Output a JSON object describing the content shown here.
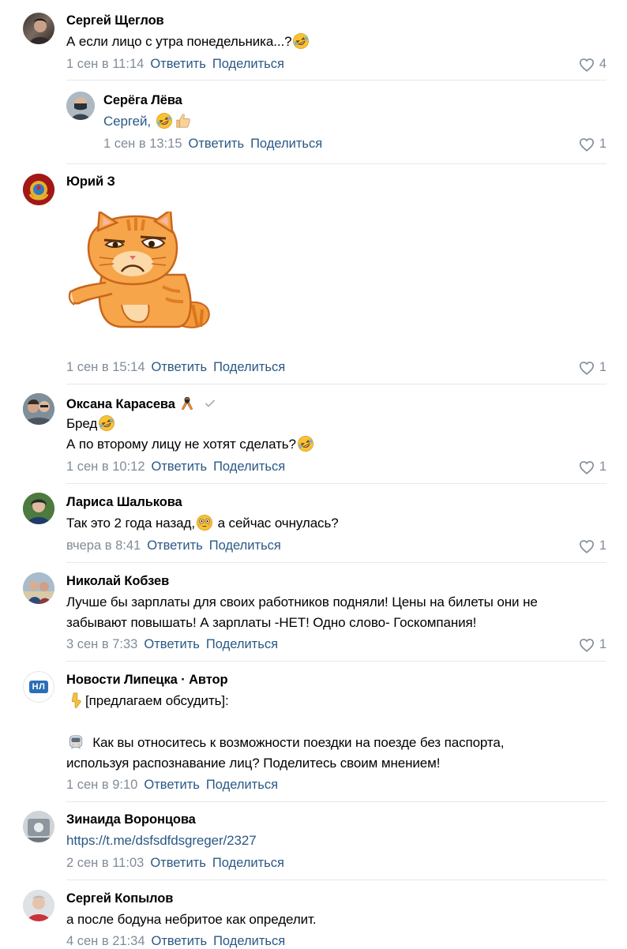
{
  "actions": {
    "reply": "Ответить",
    "share": "Поделиться"
  },
  "colors": {
    "link": "#2a5885",
    "meta": "#818c99",
    "divider": "#e7e8ec",
    "like_icon": "#818c99"
  },
  "comments": [
    {
      "author": "Сергей Щеглов",
      "text": "А если лицо с утра понедельника...?",
      "emoji": [
        "rofl-emoji"
      ],
      "date": "1 сен в 11:14",
      "likes": "4"
    },
    {
      "author": "Серёга Лёва",
      "reply_to": "Сергей,",
      "emoji": [
        "rofl-emoji",
        "thumbs-up-emoji"
      ],
      "date": "1 сен в 13:15",
      "likes": "1"
    },
    {
      "author": "Юрий З",
      "sticker": "grumpy-cat-sticker",
      "date": "1 сен в 15:14",
      "likes": "1"
    },
    {
      "author": "Оксана Карасева",
      "badges": [
        "ribbon-icon",
        "verified-check-icon"
      ],
      "text": "Бред",
      "text2": "А по второму лицу не хотят сделать?",
      "date": "1 сен в 10:12",
      "likes": "1"
    },
    {
      "author": "Лариса Шалькова",
      "text": "Так это 2 года назад,",
      "text_after_emoji": "а сейчас очнулась?",
      "emoji": [
        "flushed-emoji"
      ],
      "date": "вчера в 8:41",
      "likes": "1"
    },
    {
      "author": "Николай Кобзев",
      "text": "Лучше бы зарплаты для своих работников подняли! Цены на билеты они не",
      "text2": "забывают повышать! А зарплаты -НЕТ! Одно слово- Госкомпания!",
      "date": "3 сен в 7:33",
      "likes": "1"
    },
    {
      "author": "Новости Липецка · Автор",
      "avatar_text": "НЛ",
      "text": "[предлагаем обсудить]:",
      "text2": "Как вы относитесь к возможности поездки на поезде без паспорта,",
      "text3": "используя распознавание лиц? Поделитесь своим мнением!",
      "emoji": [
        "pointing-down-emoji",
        "train-emoji"
      ],
      "date": "1 сен в 9:10"
    },
    {
      "author": "Зинаида Воронцова",
      "link": "https://t.me/dsfsdfdsgreger/2327",
      "date": "2 сен в 11:03"
    },
    {
      "author": "Сергей Копылов",
      "text": "а после бодуна небритое как определит.",
      "date": "4 сен в 21:34"
    }
  ]
}
